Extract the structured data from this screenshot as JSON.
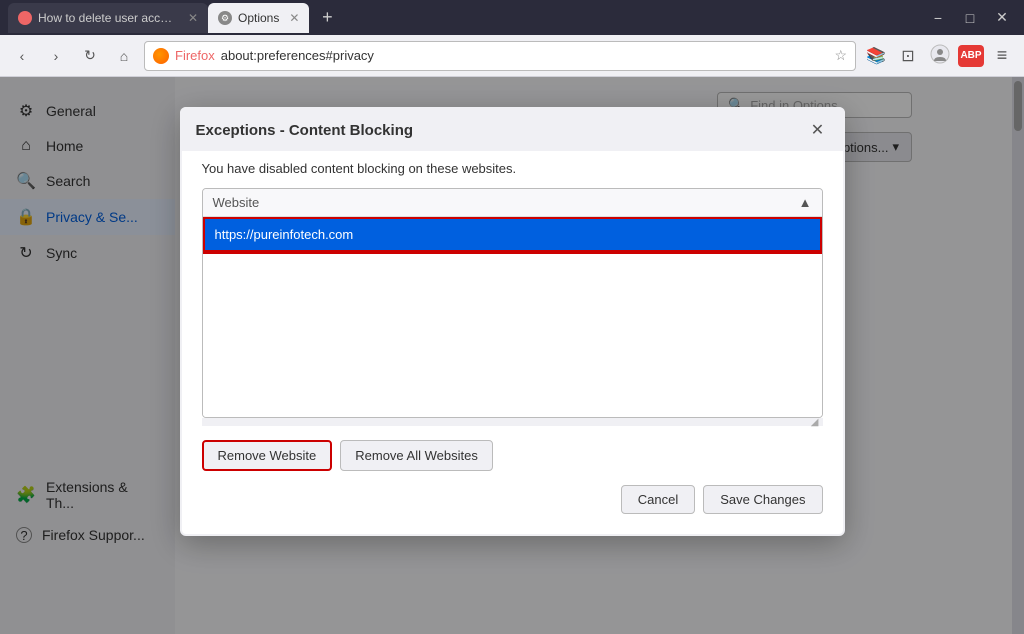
{
  "browser": {
    "tab_inactive_label": "How to delete user account o...",
    "tab_active_label": "Options",
    "new_tab_symbol": "+",
    "address": "about:preferences#privacy",
    "address_bar_brand": "Firefox",
    "win_minimize": "−",
    "win_maximize": "□",
    "win_close": "✕"
  },
  "toolbar": {
    "back_symbol": "‹",
    "forward_symbol": "›",
    "refresh_symbol": "↻",
    "home_symbol": "⌂",
    "bookmarks_symbol": "📚",
    "synced_tabs": "⊡",
    "account_symbol": "👤",
    "adblock_label": "ABP",
    "menu_symbol": "≡",
    "star_symbol": "☆"
  },
  "find_in_options": {
    "placeholder": "Find in Options",
    "icon": "🔍"
  },
  "sidebar": {
    "items": [
      {
        "id": "general",
        "icon": "⚙",
        "label": "General"
      },
      {
        "id": "home",
        "icon": "⌂",
        "label": "Home"
      },
      {
        "id": "search",
        "icon": "🔍",
        "label": "Search"
      },
      {
        "id": "privacy",
        "icon": "🔒",
        "label": "Privacy & Se..."
      },
      {
        "id": "sync",
        "icon": "↻",
        "label": "Sync"
      }
    ],
    "bottom_items": [
      {
        "id": "extensions",
        "icon": "🧩",
        "label": "Extensions & Th..."
      },
      {
        "id": "support",
        "icon": "?",
        "label": "Firefox Suppor..."
      }
    ]
  },
  "dialog": {
    "title": "Exceptions - Content Blocking",
    "close_symbol": "✕",
    "description": "You have disabled content blocking on these websites.",
    "website_header_label": "Website",
    "website_header_chevron": "▲",
    "selected_website": "https://pureinfotech.com",
    "buttons": {
      "remove_website": "Remove Website",
      "remove_all": "Remove All Websites",
      "cancel": "Cancel",
      "save_changes": "Save Changes"
    }
  },
  "background": {
    "options_btn_label": "ptions...",
    "dropdown_chevron": "▾"
  }
}
